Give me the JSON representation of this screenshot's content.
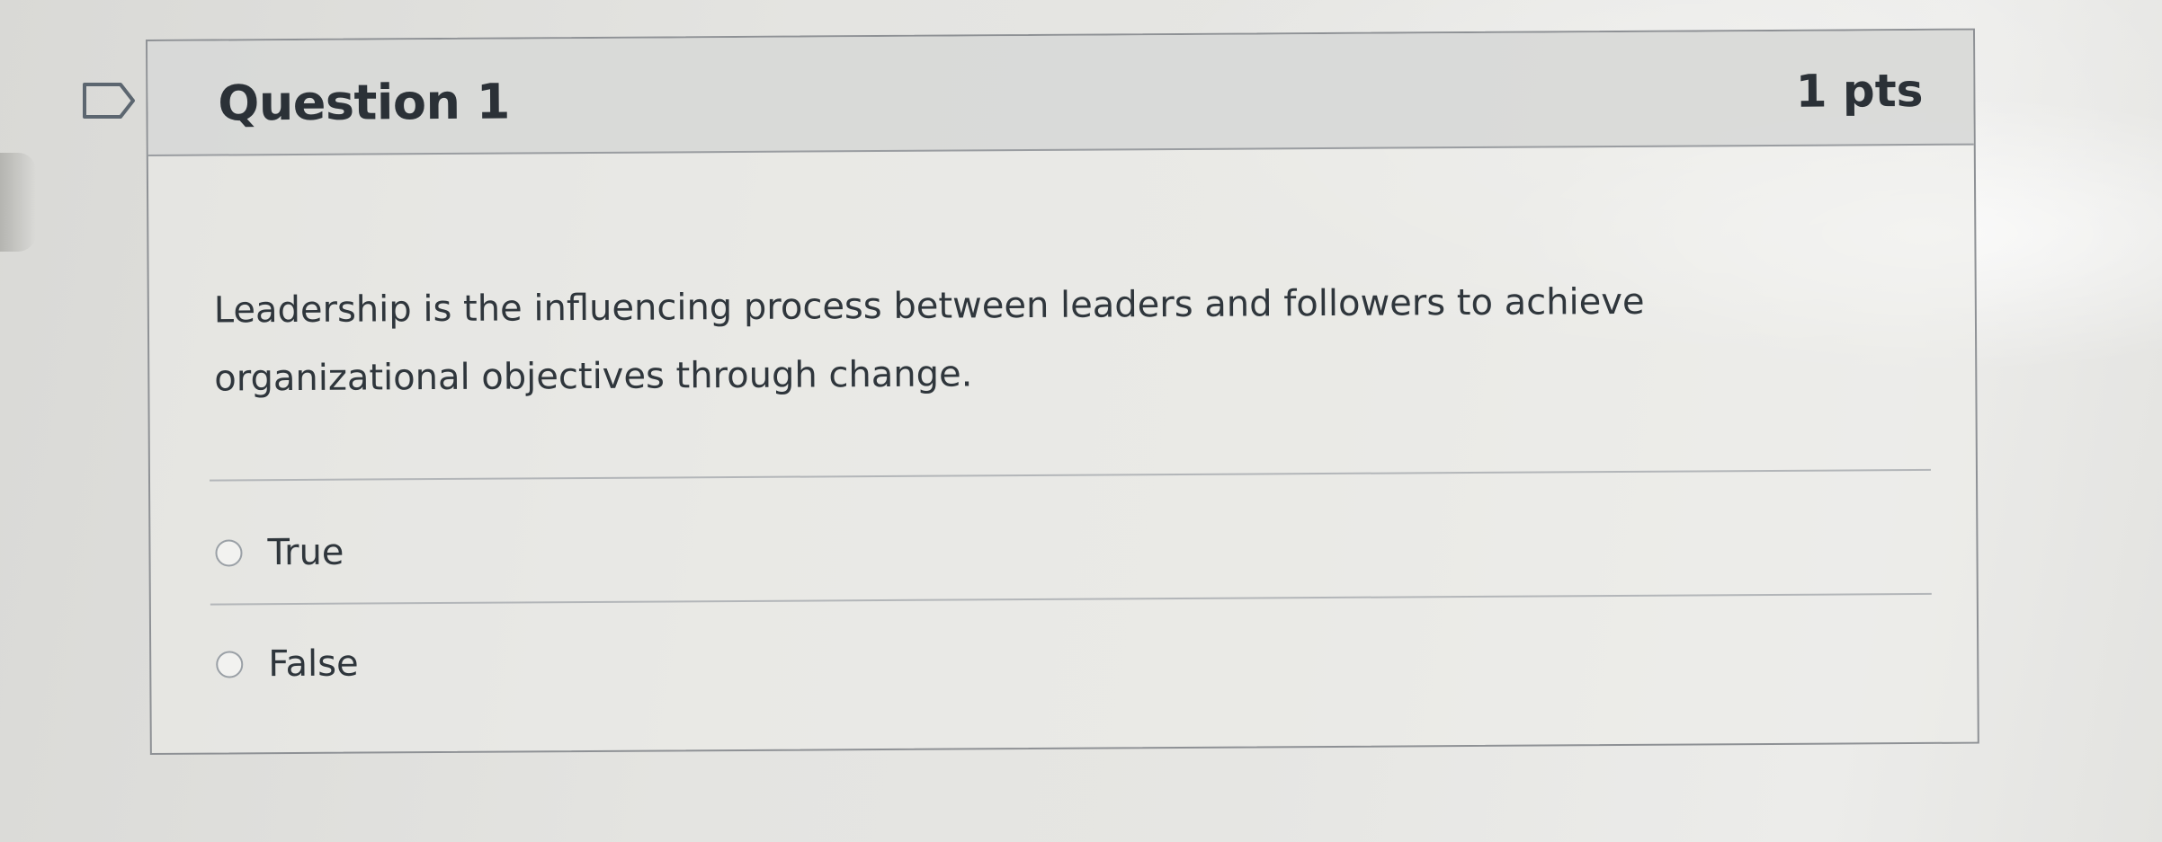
{
  "question": {
    "title": "Question 1",
    "points": "1 pts",
    "text_line1": "Leadership is the influencing process between leaders and followers to achieve",
    "text_line2": "organizational objectives through change.",
    "answers": [
      {
        "label": "True",
        "selected": false
      },
      {
        "label": "False",
        "selected": false
      }
    ]
  },
  "icons": {
    "flag": "flag-outline-icon"
  },
  "colors": {
    "header_bg": "#d6d7d6",
    "border": "#8e9195",
    "text": "#2b3137"
  }
}
